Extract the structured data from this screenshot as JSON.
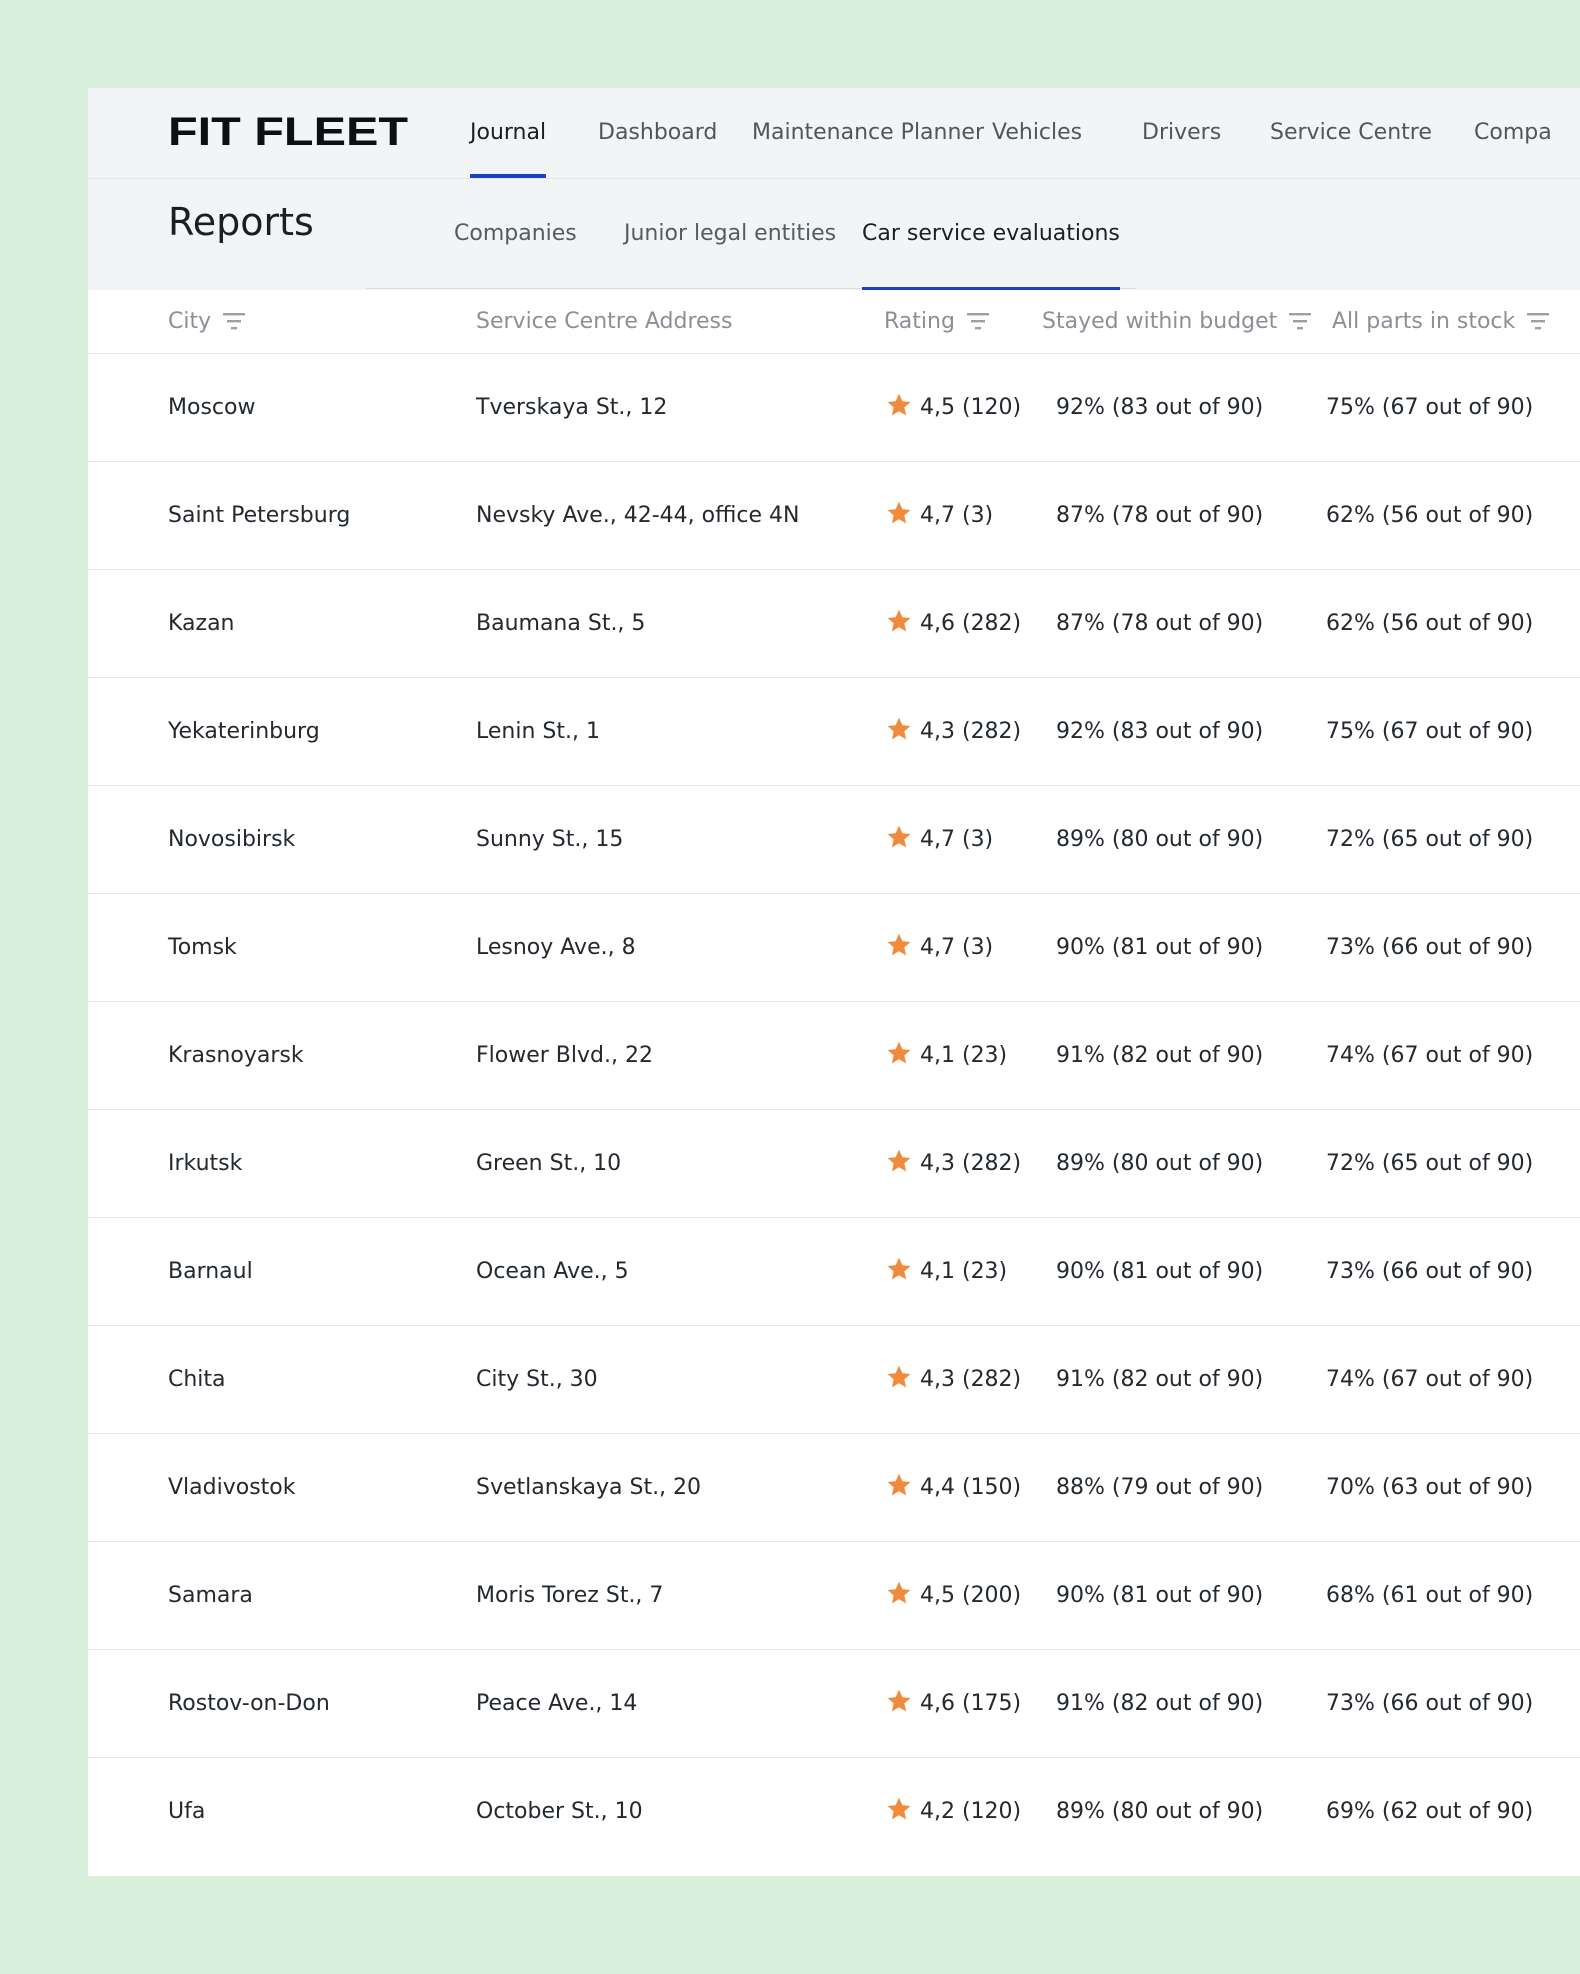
{
  "app": {
    "logo_text": "FIT FLEET",
    "nav": [
      {
        "label": "Journal",
        "active": true
      },
      {
        "label": "Dashboard",
        "active": false
      },
      {
        "label": "Maintenance Planner",
        "active": false
      },
      {
        "label": "Vehicles",
        "active": false
      },
      {
        "label": "Drivers",
        "active": false
      },
      {
        "label": "Service Centre",
        "active": false
      },
      {
        "label": "Compa",
        "active": false
      }
    ]
  },
  "reports": {
    "title": "Reports",
    "tabs": [
      {
        "label": "Companies",
        "active": false
      },
      {
        "label": "Junior legal entities",
        "active": false
      },
      {
        "label": "Car service evaluations",
        "active": true
      }
    ]
  },
  "table": {
    "columns": [
      "City",
      "Service Centre Address",
      "Rating",
      "Stayed within budget",
      "All parts in stock"
    ],
    "rows": [
      {
        "city": "Moscow",
        "address": "Tverskaya St., 12",
        "rating": "4,5 (120)",
        "budget": "92% (83 out of 90)",
        "stock": "75% (67 out of 90)"
      },
      {
        "city": "Saint Petersburg",
        "address": "Nevsky Ave., 42-44, office 4N",
        "rating": "4,7 (3)",
        "budget": "87% (78 out of 90)",
        "stock": "62% (56 out of 90)"
      },
      {
        "city": "Kazan",
        "address": "Baumana St., 5",
        "rating": "4,6 (282)",
        "budget": "87% (78 out of 90)",
        "stock": "62% (56 out of 90)"
      },
      {
        "city": "Yekaterinburg",
        "address": "Lenin St., 1",
        "rating": "4,3 (282)",
        "budget": "92% (83 out of 90)",
        "stock": "75% (67 out of 90)"
      },
      {
        "city": "Novosibirsk",
        "address": "Sunny St., 15",
        "rating": "4,7 (3)",
        "budget": "89% (80 out of 90)",
        "stock": "72% (65 out of 90)"
      },
      {
        "city": "Tomsk",
        "address": "Lesnoy Ave., 8",
        "rating": "4,7 (3)",
        "budget": "90% (81 out of 90)",
        "stock": "73% (66 out of 90)"
      },
      {
        "city": "Krasnoyarsk",
        "address": "Flower Blvd., 22",
        "rating": "4,1 (23)",
        "budget": "91% (82 out of 90)",
        "stock": "74% (67 out of 90)"
      },
      {
        "city": "Irkutsk",
        "address": "Green St., 10",
        "rating": "4,3 (282)",
        "budget": "89% (80 out of 90)",
        "stock": "72% (65 out of 90)"
      },
      {
        "city": "Barnaul",
        "address": "Ocean Ave., 5",
        "rating": "4,1 (23)",
        "budget": "90% (81 out of 90)",
        "stock": "73% (66 out of 90)"
      },
      {
        "city": "Chita",
        "address": "City St., 30",
        "rating": "4,3 (282)",
        "budget": "91% (82 out of 90)",
        "stock": "74% (67 out of 90)"
      },
      {
        "city": "Vladivostok",
        "address": "Svetlanskaya St., 20",
        "rating": "4,4 (150)",
        "budget": "88% (79 out of 90)",
        "stock": "70% (63 out of 90)"
      },
      {
        "city": "Samara",
        "address": "Moris Torez St., 7",
        "rating": "4,5 (200)",
        "budget": "90% (81 out of 90)",
        "stock": "68% (61 out of 90)"
      },
      {
        "city": "Rostov-on-Don",
        "address": "Peace Ave., 14",
        "rating": "4,6 (175)",
        "budget": "91% (82 out of 90)",
        "stock": "73% (66 out of 90)"
      },
      {
        "city": "Ufa",
        "address": "October St., 10",
        "rating": "4,2 (120)",
        "budget": "89% (80 out of 90)",
        "stock": "69% (62 out of 90)"
      }
    ]
  },
  "colors": {
    "accent": "#1d3fc4",
    "star": "#f08a3c",
    "background": "#d8f0dc",
    "header_bg": "#f1f5f6"
  },
  "icons": {
    "filter": "filter-icon",
    "rating": "star-icon"
  }
}
